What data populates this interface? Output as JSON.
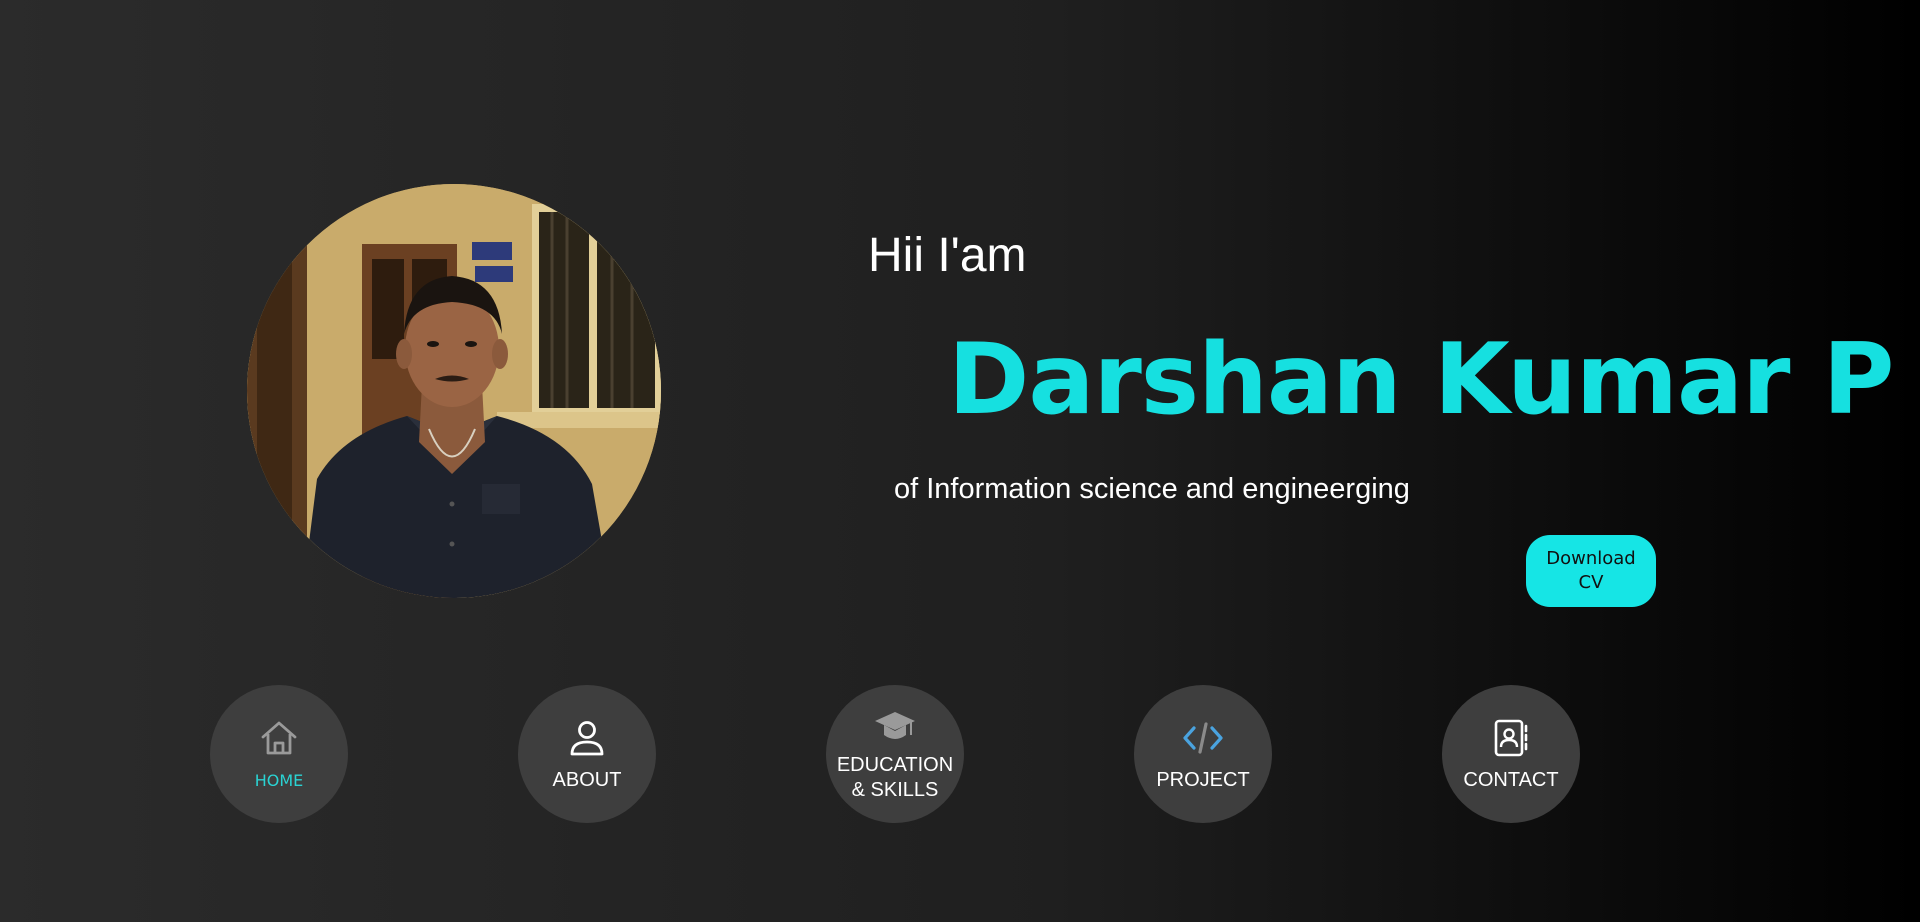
{
  "hero": {
    "greeting": "Hii I'am",
    "name": "Darshan Kumar P",
    "tagline": "of Information science and engineerging",
    "download_label_line1": "Download",
    "download_label_line2": "CV"
  },
  "nav": {
    "home": "HOME",
    "about": "ABOUT",
    "education_line1": "EDUCATION",
    "education_line2": "& SKILLS",
    "project": "PROJECT",
    "contact": "CONTACT"
  },
  "colors": {
    "accent": "#16e0e0",
    "nav_circle": "#3e3e3e",
    "project_icon": "#4aa3df"
  }
}
